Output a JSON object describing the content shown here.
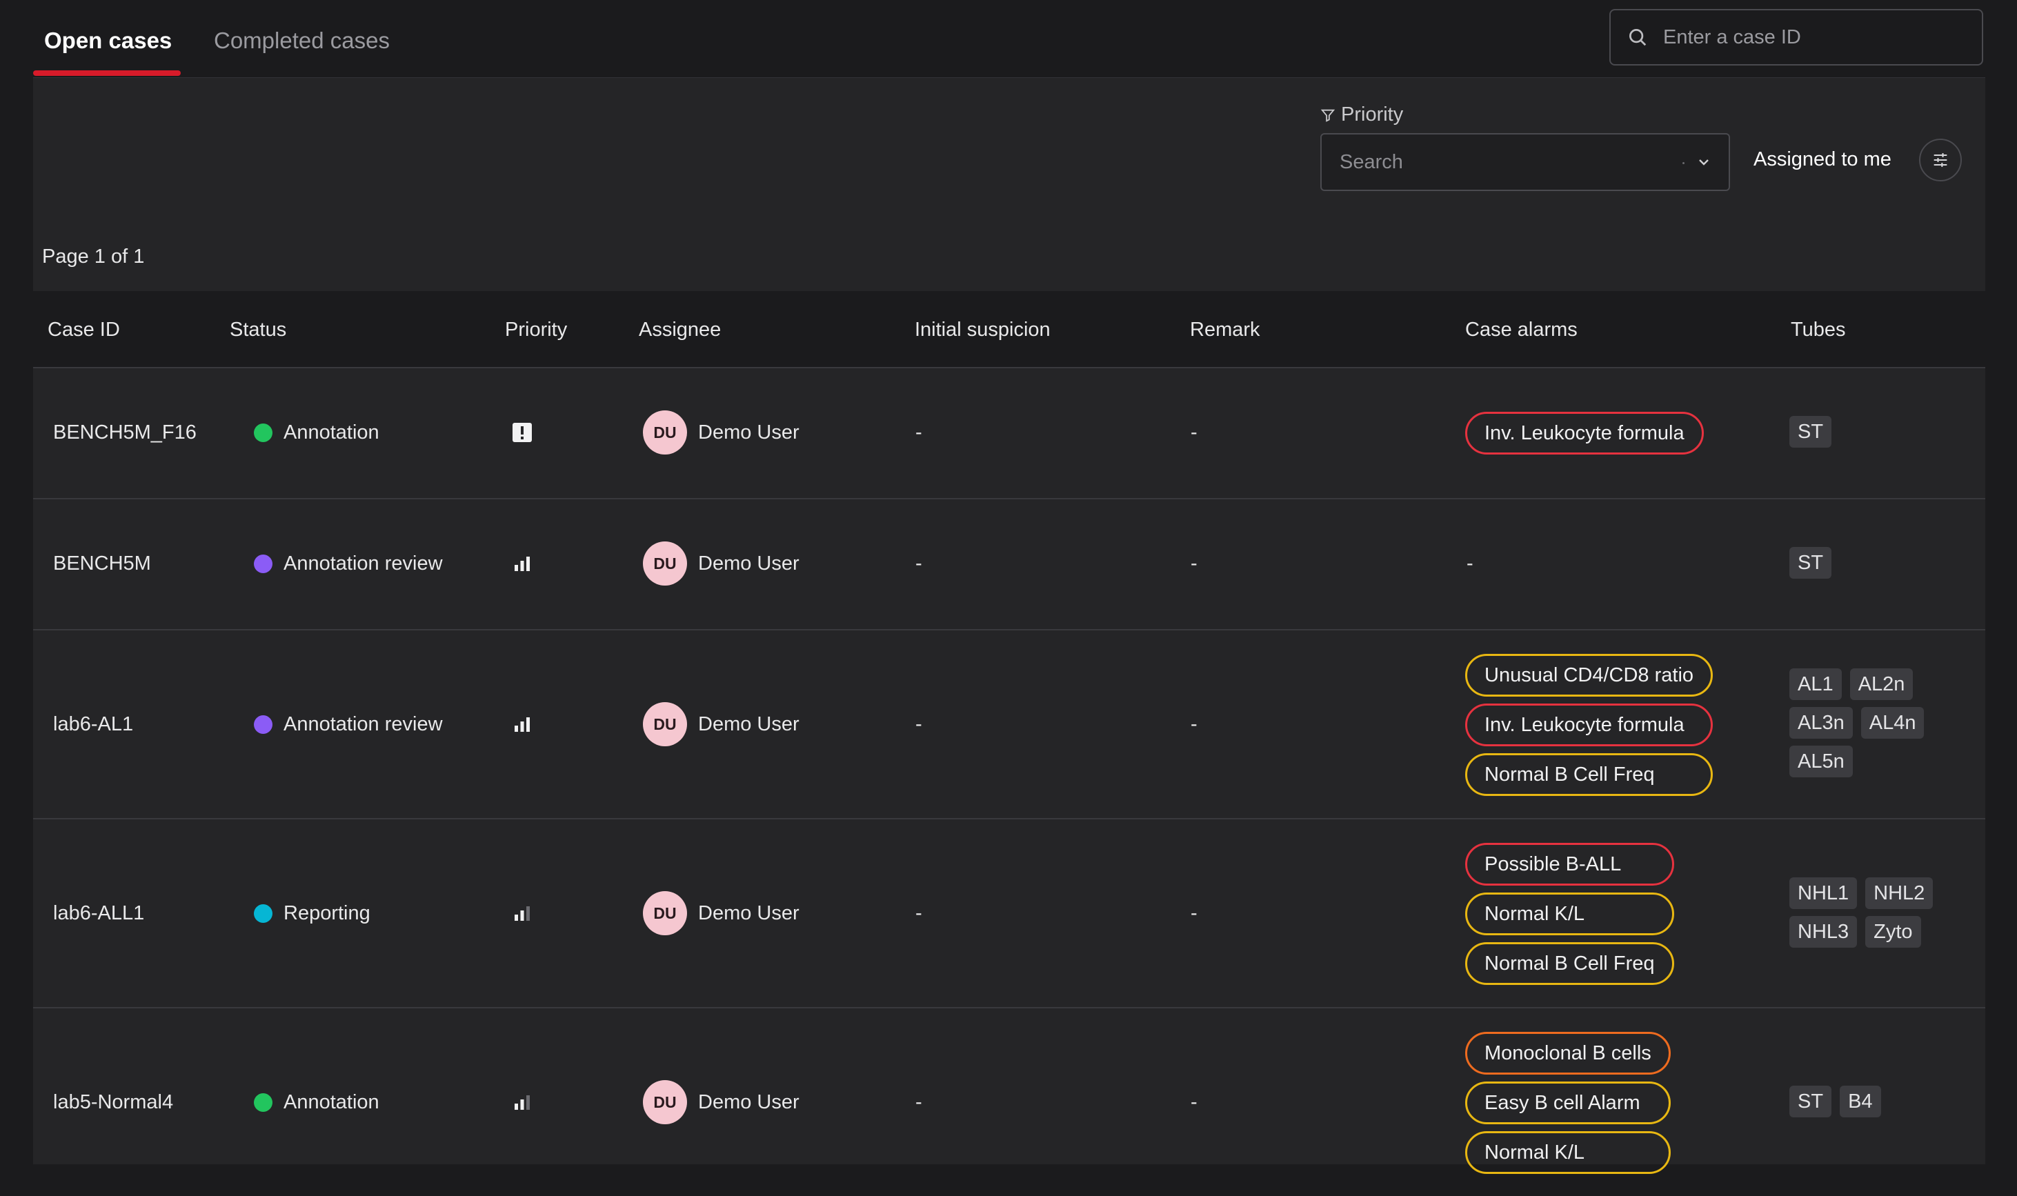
{
  "tabs": {
    "open": "Open cases",
    "completed": "Completed cases"
  },
  "search": {
    "placeholder": "Enter a case ID"
  },
  "filter": {
    "label": "Priority",
    "placeholder": "Search"
  },
  "assigned_label": "Assigned to me",
  "page_info": "Page 1 of 1",
  "columns": [
    "Case ID",
    "Status",
    "Priority",
    "Assignee",
    "Initial suspicion",
    "Remark",
    "Case alarms",
    "Tubes"
  ],
  "colors": {
    "accent": "#d81b2a",
    "status_annotation": "#22c55e",
    "status_review": "#8b5cf6",
    "status_reporting": "#06b6d4",
    "alarm_red": "#e6323f",
    "alarm_yellow": "#e8b712",
    "alarm_orange": "#ee6b1f"
  },
  "rows": [
    {
      "case_id": "BENCH5M_F16",
      "status": "Annotation",
      "status_color": "#22c55e",
      "priority_icon": "urgent-icon",
      "avatar": "DU",
      "assignee": "Demo User",
      "initial": "-",
      "remark": "-",
      "alarms": [
        {
          "label": "Inv. Leukocyte formula",
          "level": "red"
        }
      ],
      "alarms_empty": "",
      "tubes": [
        "ST"
      ]
    },
    {
      "case_id": "BENCH5M",
      "status": "Annotation review",
      "status_color": "#8b5cf6",
      "priority_icon": "priority-high-icon",
      "avatar": "DU",
      "assignee": "Demo User",
      "initial": "-",
      "remark": "-",
      "alarms": [],
      "alarms_empty": "-",
      "tubes": [
        "ST"
      ]
    },
    {
      "case_id": "lab6-AL1",
      "status": "Annotation review",
      "status_color": "#8b5cf6",
      "priority_icon": "priority-high-icon",
      "avatar": "DU",
      "assignee": "Demo User",
      "initial": "-",
      "remark": "-",
      "alarms": [
        {
          "label": "Unusual CD4/CD8 ratio",
          "level": "yellow"
        },
        {
          "label": "Inv. Leukocyte formula",
          "level": "red"
        },
        {
          "label": "Normal B Cell Freq",
          "level": "yellow"
        }
      ],
      "alarms_empty": "",
      "tubes": [
        "AL1",
        "AL2n",
        "AL3n",
        "AL4n",
        "AL5n"
      ]
    },
    {
      "case_id": "lab6-ALL1",
      "status": "Reporting",
      "status_color": "#06b6d4",
      "priority_icon": "priority-medium-icon",
      "avatar": "DU",
      "assignee": "Demo User",
      "initial": "-",
      "remark": "-",
      "alarms": [
        {
          "label": "Possible B-ALL",
          "level": "red"
        },
        {
          "label": "Normal K/L",
          "level": "yellow"
        },
        {
          "label": "Normal B Cell Freq",
          "level": "yellow"
        }
      ],
      "alarms_empty": "",
      "tubes": [
        "NHL1",
        "NHL2",
        "NHL3",
        "Zyto"
      ]
    },
    {
      "case_id": "lab5-Normal4",
      "status": "Annotation",
      "status_color": "#22c55e",
      "priority_icon": "priority-medium-icon",
      "avatar": "DU",
      "assignee": "Demo User",
      "initial": "-",
      "remark": "-",
      "alarms": [
        {
          "label": "Monoclonal B cells",
          "level": "orange"
        },
        {
          "label": "Easy B cell Alarm",
          "level": "yellow"
        },
        {
          "label": "Normal K/L",
          "level": "yellow"
        }
      ],
      "alarms_empty": "",
      "tubes": [
        "ST",
        "B4"
      ]
    }
  ]
}
